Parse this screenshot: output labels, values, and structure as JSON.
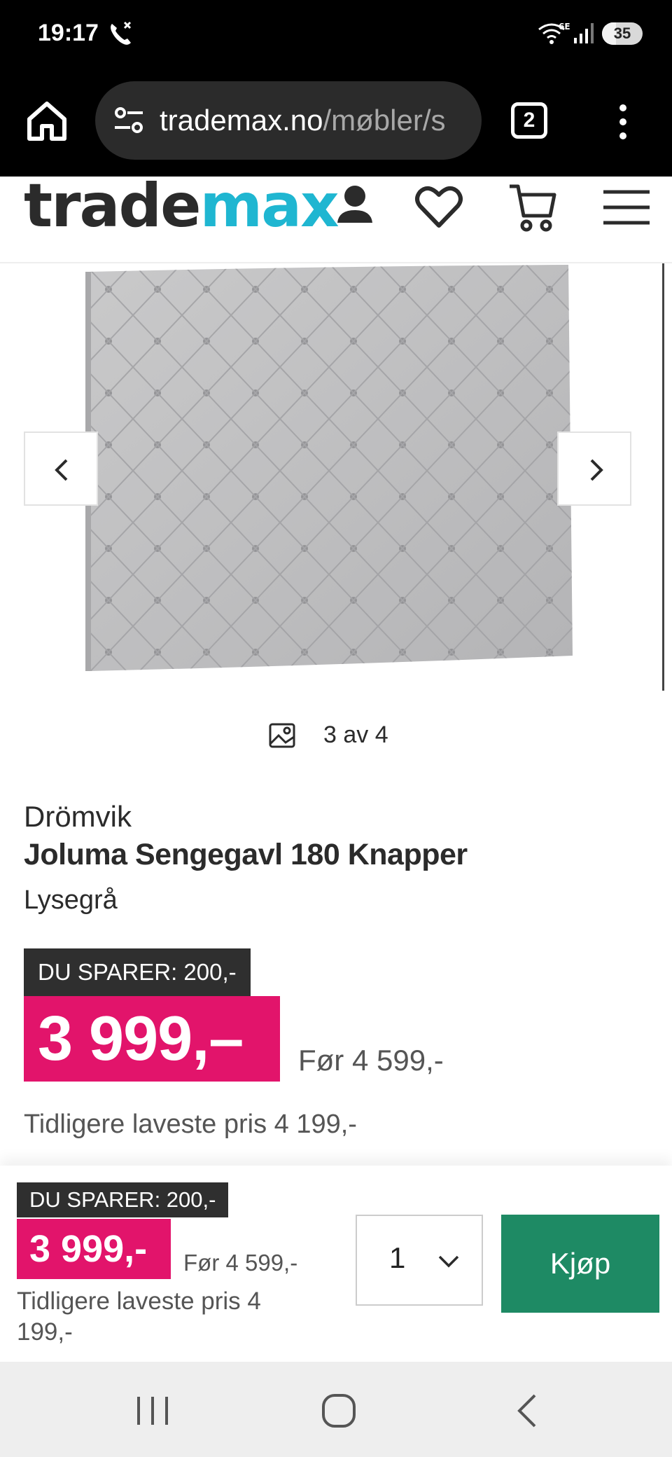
{
  "status_bar": {
    "time": "19:17",
    "battery_level": "35",
    "network": "6E"
  },
  "browser": {
    "url_domain": "trademax.no",
    "url_path": "/møbler/s",
    "tab_count": "2"
  },
  "site": {
    "logo_part1": "trade",
    "logo_part2": "max",
    "logo_accent_color": "#1fb6d1"
  },
  "gallery": {
    "counter": "3 av 4",
    "current_image": 3,
    "total_images": 4
  },
  "product": {
    "brand": "Drömvik",
    "title": "Joluma Sengegavl 180 Knapper",
    "variant": "Lysegrå",
    "save_label": "DU SPARER: 200,-",
    "price": "3 999,–",
    "before_price": "Før 4 599,-",
    "lowest_price": "Tidligere laveste pris 4 199,-"
  },
  "sticky_bar": {
    "save_label": "DU SPARER: 200,-",
    "price": "3 999,-",
    "before_price": "Før 4 599,-",
    "lowest_price": "Tidligere laveste pris 4 199,-",
    "quantity": "1",
    "buy_label": "Kjøp"
  },
  "colors": {
    "price_pink": "#e2146b",
    "buy_green": "#1e8a64",
    "badge_dark": "#2f2f2f"
  }
}
